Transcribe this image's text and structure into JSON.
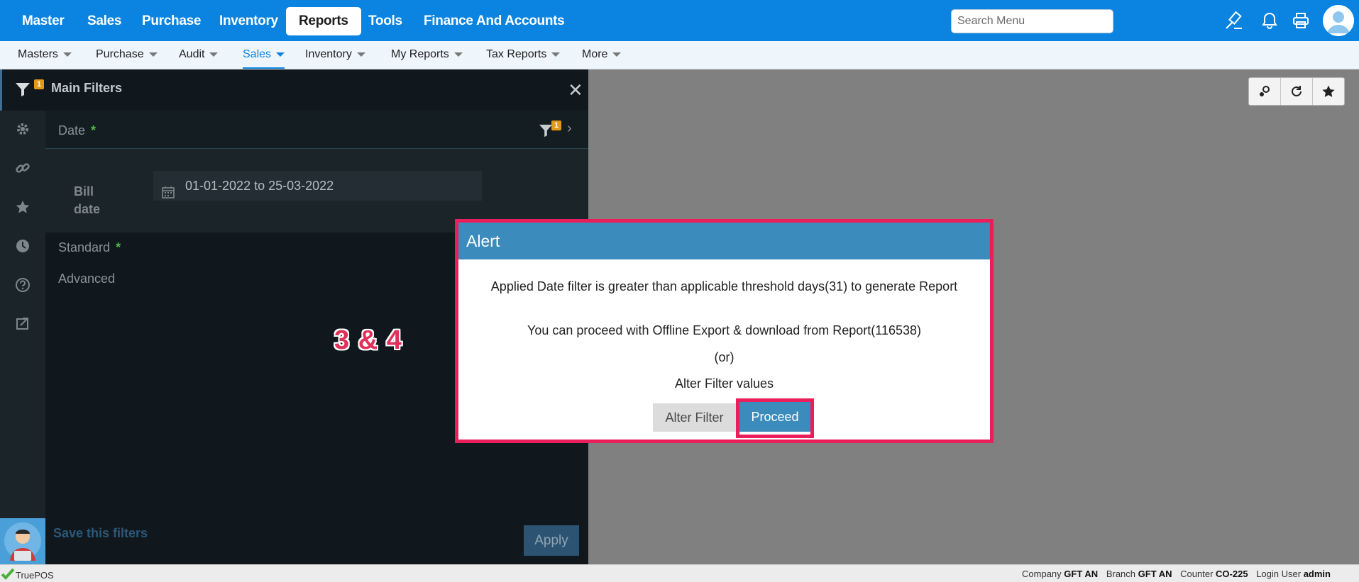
{
  "topnav": {
    "tabs": [
      {
        "label": "Master"
      },
      {
        "label": "Sales"
      },
      {
        "label": "Purchase"
      },
      {
        "label": "Inventory"
      },
      {
        "label": "Reports",
        "active": true
      },
      {
        "label": "Tools"
      },
      {
        "label": "Finance And Accounts"
      }
    ],
    "search_placeholder": "Search Menu",
    "icons": [
      "gavel-icon",
      "bell-icon",
      "printer-icon",
      "user-avatar-icon"
    ],
    "accent_color": "#0a84e0"
  },
  "subnav": {
    "items": [
      {
        "label": "Masters"
      },
      {
        "label": "Purchase"
      },
      {
        "label": "Audit"
      },
      {
        "label": "Sales",
        "active": true
      },
      {
        "label": "Inventory"
      },
      {
        "label": "My Reports"
      },
      {
        "label": "Tax Reports"
      },
      {
        "label": "More"
      }
    ]
  },
  "filters": {
    "title": "Main Filters",
    "filter_badge": "1",
    "date_label": "Date",
    "date_badge": "1",
    "required_mark": "*",
    "bill_date_label": "Bill date",
    "date_range": "01-01-2022 to 25-03-2022",
    "standard_label": "Standard",
    "advanced_label": "Advanced",
    "save_label": "Save this filters",
    "apply_label": "Apply",
    "rail_icons": [
      "filter-icon",
      "gear-icon",
      "link-icon",
      "star-icon",
      "clock-icon",
      "help-icon",
      "export-icon"
    ]
  },
  "annotation": "3 & 4",
  "right_toolbar": {
    "icons": [
      "settings-key-icon",
      "refresh-icon",
      "star-icon"
    ]
  },
  "alert": {
    "title": "Alert",
    "line1": "Applied Date filter is greater than applicable threshold days(31) to generate Report",
    "line2": "You can proceed with Offline Export & download from Report(116538)",
    "line3": "(or)",
    "line4": "Alter Filter values",
    "alter_label": "Alter Filter",
    "proceed_label": "Proceed",
    "highlight_color": "#ea1e5b"
  },
  "status": {
    "app_name": "TruePOS",
    "company_label": "Company",
    "company_value": "GFT AN",
    "branch_label": "Branch",
    "branch_value": "GFT AN",
    "counter_label": "Counter",
    "counter_value": "CO-225",
    "login_label": "Login User",
    "login_value": "admin"
  }
}
